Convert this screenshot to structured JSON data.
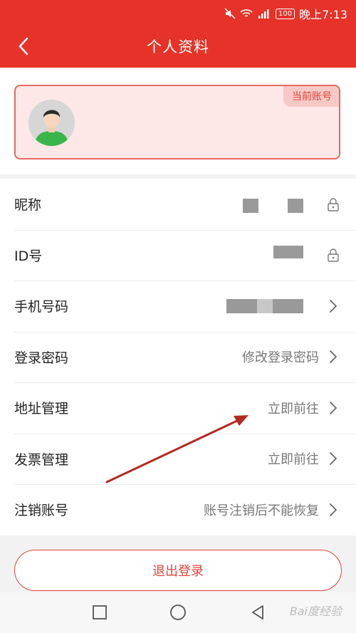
{
  "status_bar": {
    "battery": "100",
    "time": "晚上7:13"
  },
  "header": {
    "title": "个人资料"
  },
  "account_card": {
    "badge": "当前账号"
  },
  "rows": [
    {
      "label": "昵称",
      "value": "",
      "icon": "lock-icon"
    },
    {
      "label": "ID号",
      "value": "",
      "icon": "lock-icon"
    },
    {
      "label": "手机号码",
      "value": "",
      "icon": "chevron-right-icon"
    },
    {
      "label": "登录密码",
      "value": "修改登录密码",
      "icon": "chevron-right-icon"
    },
    {
      "label": "地址管理",
      "value": "立即前往",
      "icon": "chevron-right-icon"
    },
    {
      "label": "发票管理",
      "value": "立即前往",
      "icon": "chevron-right-icon"
    },
    {
      "label": "注销账号",
      "value": "账号注销后不能恢复",
      "icon": "chevron-right-icon"
    }
  ],
  "logout": {
    "label": "退出登录"
  },
  "watermark": "Bai度经验",
  "colors": {
    "brand_red": "#e63228",
    "annotation_arrow": "#b22a22"
  }
}
